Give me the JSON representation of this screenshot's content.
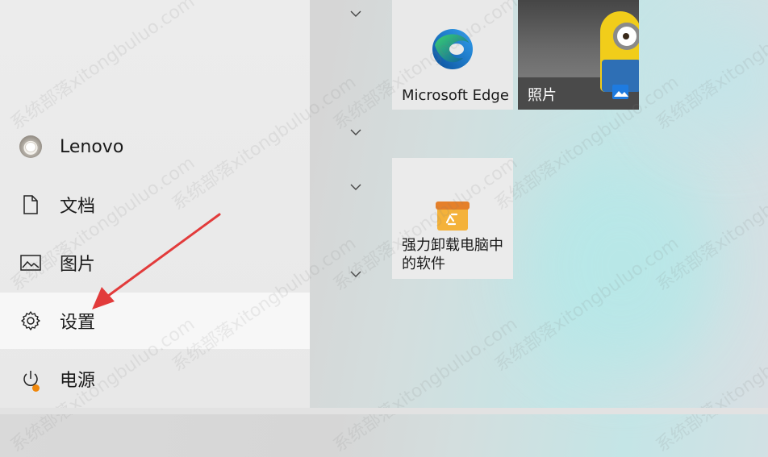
{
  "start_menu": {
    "user": {
      "name": "Lenovo",
      "icon": "user-avatar"
    },
    "items": [
      {
        "label": "文档",
        "icon": "document-icon"
      },
      {
        "label": "图片",
        "icon": "picture-icon"
      },
      {
        "label": "设置",
        "icon": "gear-icon"
      },
      {
        "label": "电源",
        "icon": "power-icon"
      }
    ]
  },
  "tiles": {
    "edge": {
      "label": "Microsoft Edge",
      "icon": "edge-icon"
    },
    "photos": {
      "label": "照片",
      "icon": "photos-icon"
    },
    "uninstall": {
      "label_line1": "强力卸载电脑中",
      "label_line2": "的软件",
      "icon": "recycle-box-icon"
    }
  },
  "watermark": "系统部落xitongbuluo.com",
  "colors": {
    "accent": "#e23b3b",
    "power_badge": "#f0880c"
  }
}
